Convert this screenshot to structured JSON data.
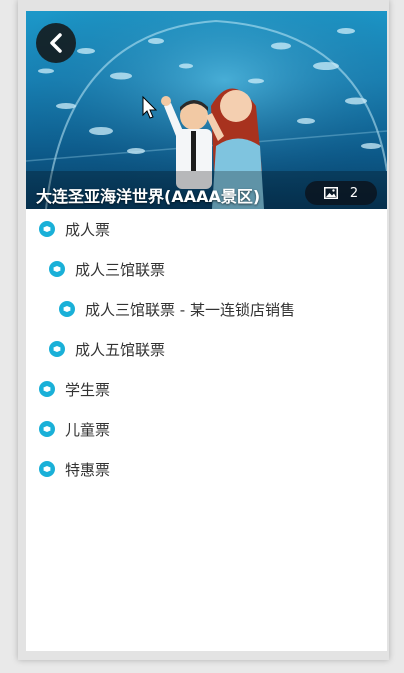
{
  "header": {
    "title": "大连圣亚海洋世界(AAAA景区)",
    "photo_count": "2",
    "back_icon": "chevron-left-icon",
    "photo_icon": "image-icon"
  },
  "tickets": [
    {
      "label": "成人票",
      "level": 0
    },
    {
      "label": "成人三馆联票",
      "level": 1
    },
    {
      "label": "成人三馆联票 - 某一连锁店销售",
      "level": 2
    },
    {
      "label": "成人五馆联票",
      "level": 1
    },
    {
      "label": "学生票",
      "level": 0
    },
    {
      "label": "儿童票",
      "level": 0
    },
    {
      "label": "特惠票",
      "level": 0
    }
  ],
  "colors": {
    "accent": "#1ab0d8",
    "text": "#333333"
  }
}
